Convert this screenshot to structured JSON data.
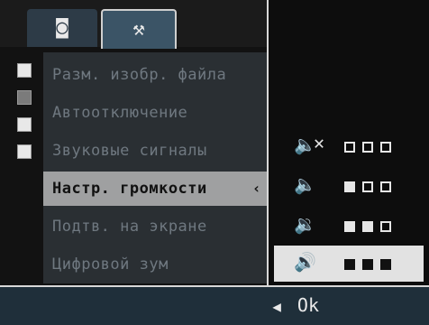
{
  "tabs": [
    {
      "name": "camera",
      "icon": "camera-icon",
      "glyph": "◙"
    },
    {
      "name": "setup",
      "icon": "tools-icon",
      "glyph": "⚒"
    }
  ],
  "menu": {
    "items": [
      {
        "label": "Разм. изобр. файла",
        "selected": false
      },
      {
        "label": "Автоотключение",
        "selected": false
      },
      {
        "label": "Звуковые сигналы",
        "selected": false
      },
      {
        "label": "Настр. громкости",
        "selected": true
      },
      {
        "label": "Подтв. на экране",
        "selected": false
      },
      {
        "label": "Цифровой зум",
        "selected": false
      }
    ],
    "selected_arrow": "‹"
  },
  "volume": {
    "levels": [
      {
        "icon": "speaker-mute-icon",
        "glyph": "🔈",
        "mute_glyph": "✕",
        "filled": 0,
        "total": 3,
        "selected": false
      },
      {
        "icon": "speaker-low-icon",
        "glyph": "🔈",
        "filled": 1,
        "total": 3,
        "selected": false
      },
      {
        "icon": "speaker-mid-icon",
        "glyph": "🔉",
        "filled": 2,
        "total": 3,
        "selected": false
      },
      {
        "icon": "speaker-high-icon",
        "glyph": "🔊",
        "filled": 3,
        "total": 3,
        "selected": true
      }
    ]
  },
  "footer": {
    "ok_label": "Ok",
    "arrow_glyph": "◀"
  }
}
